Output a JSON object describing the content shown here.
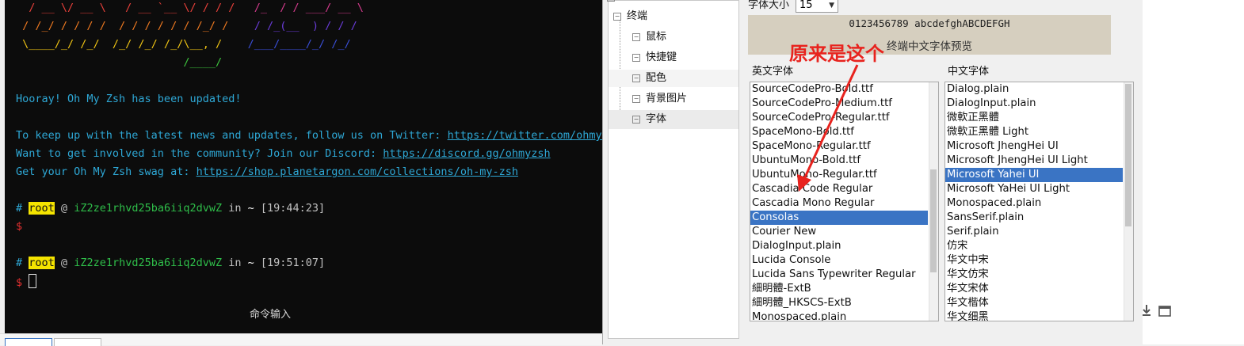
{
  "terminal": {
    "ascii_lines": [
      {
        "parts": [
          {
            "t": "  / __ \\/ __ \\   / __ `__ \\/ / / /  ",
            "c": "#e8403a"
          },
          {
            "t": " /_  / / ___/ __ \\",
            "c": "#d63c8e"
          }
        ]
      },
      {
        "parts": [
          {
            "t": " / /_/ / / / /  / / / / / / /_/ /  ",
            "c": "#ef7a21"
          },
          {
            "t": "  / /_(__  ) / / /",
            "c": "#6a3cd9"
          }
        ]
      },
      {
        "parts": [
          {
            "t": " \\____/_/ /_/  /_/ /_/ /_/\\__, /   ",
            "c": "#f0c414"
          },
          {
            "t": " /___/____/_/ /_/",
            "c": "#3a4fd8"
          }
        ]
      },
      {
        "parts": [
          {
            "t": "                          /____/",
            "c": "#3ec43e"
          }
        ]
      }
    ],
    "updated_msg": "Hooray! Oh My Zsh has been updated!",
    "twitter_text": "To keep up with the latest news and updates, follow us on Twitter: ",
    "twitter_link": "https://twitter.com/ohmyzsh",
    "discord_text": "Want to get involved in the community? Join our Discord: ",
    "discord_link": "https://discord.gg/ohmyzsh",
    "swag_text": "Get your Oh My Zsh swag at: ",
    "swag_link": "https://shop.planetargon.com/collections/oh-my-zsh",
    "prompts": [
      {
        "hash": "#",
        "user": "root",
        "at": " @ ",
        "host": "iZ2ze1rhvd25ba6iiq2dvwZ",
        "in": " in ",
        "dir": "~",
        "time": " [19:44:23]",
        "dollar": "$"
      },
      {
        "hash": "#",
        "user": "root",
        "at": " @ ",
        "host": "iZ2ze1rhvd25ba6iiq2dvwZ",
        "in": " in ",
        "dir": "~",
        "time": " [19:51:07]",
        "dollar": "$"
      }
    ],
    "command_input_label": "命令输入"
  },
  "tree": {
    "items": [
      "终端",
      "鼠标",
      "快捷键",
      "配色",
      "背景图片",
      "字体"
    ],
    "selected": "字体"
  },
  "font_settings": {
    "size_label": "字体大小",
    "size_value": "15",
    "preview_en": "0123456789 abcdefghABCDEFGH",
    "preview_cn": "终端中文字体预览",
    "english_header": "英文字体",
    "chinese_header": "中文字体",
    "english_fonts": [
      "SourceCodePro-Bold.ttf",
      "SourceCodePro-Medium.ttf",
      "SourceCodePro-Regular.ttf",
      "SpaceMono-Bold.ttf",
      "SpaceMono-Regular.ttf",
      "UbuntuMono-Bold.ttf",
      "UbuntuMono-Regular.ttf",
      "Cascadia Code Regular",
      "Cascadia Mono Regular",
      "Consolas",
      "Courier New",
      "DialogInput.plain",
      "Lucida Console",
      "Lucida Sans Typewriter Regular",
      "細明體-ExtB",
      "細明體_HKSCS-ExtB",
      "Monospaced.plain"
    ],
    "english_selected": "Consolas",
    "chinese_fonts": [
      "Dialog.plain",
      "DialogInput.plain",
      "微軟正黑體",
      "微軟正黑體 Light",
      "Microsoft JhengHei UI",
      "Microsoft JhengHei UI Light",
      "Microsoft Yahei UI",
      "Microsoft YaHei UI Light",
      "Monospaced.plain",
      "SansSerif.plain",
      "Serif.plain",
      "仿宋",
      "华文中宋",
      "华文仿宋",
      "华文宋体",
      "华文楷体",
      "华文细黑"
    ],
    "chinese_selected": "Microsoft Yahei UI"
  },
  "annotation": {
    "text": "原来是这个",
    "color": "#e8231e"
  },
  "icons": [
    "download-icon",
    "window-icon"
  ]
}
